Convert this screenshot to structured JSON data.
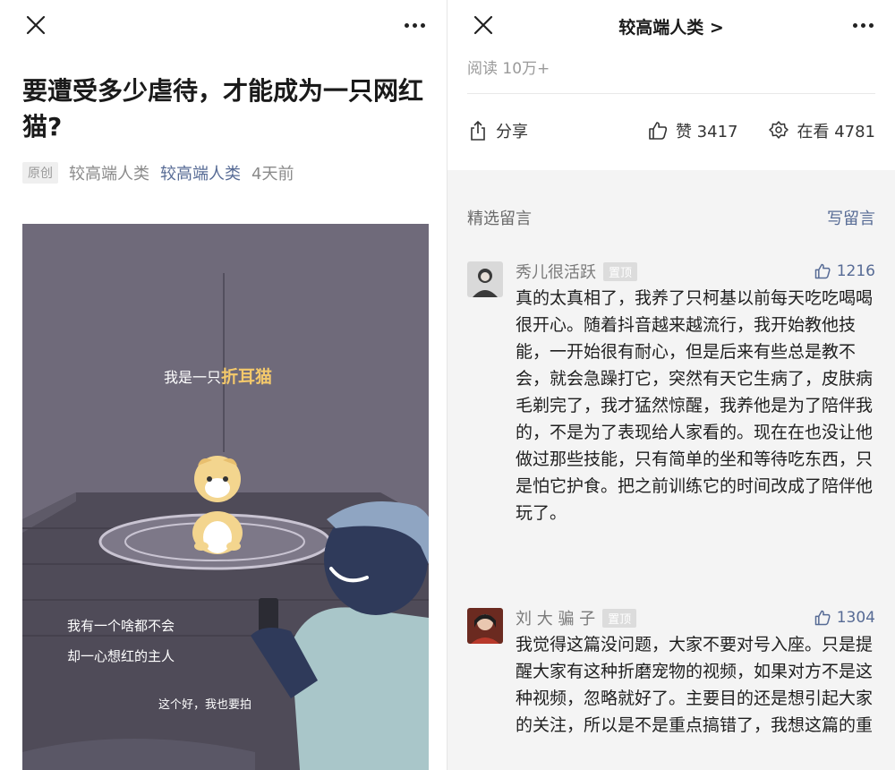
{
  "left": {
    "title": "要遭受多少虐待，才能成为一只网红猫?",
    "meta": {
      "original_tag": "原创",
      "author": "较高端人类",
      "account": "较高端人类",
      "time": "4天前"
    },
    "illustration": {
      "caption1_prefix": "我是一只",
      "caption1_highlight": "折耳猫",
      "caption2_line1": "我有一个啥都不会",
      "caption2_line2": "却一心想红的主人",
      "caption3": "这个好，我也要拍"
    }
  },
  "right": {
    "header_title": "较高端人类 >",
    "read_count": "阅读 10万+",
    "actions": {
      "share": "分享",
      "like": "赞 3417",
      "watching": "在看 4781"
    },
    "comments_label": "精选留言",
    "write_comment": "写留言",
    "comments": [
      {
        "name": "秀儿很活跃",
        "pin": "置顶",
        "likes": "1216",
        "text": "真的太真相了，我养了只柯基以前每天吃吃喝喝很开心。随着抖音越来越流行，我开始教他技能，一开始很有耐心，但是后来有些总是教不会，就会急躁打它，突然有天它生病了，皮肤病毛剃完了，我才猛然惊醒，我养他是为了陪伴我的，不是为了表现给人家看的。现在在也没让他做过那些技能，只有简单的坐和等待吃东西，只是怕它护食。把之前训练它的时间改成了陪伴他玩了。"
      },
      {
        "name": "刘 大 骗 子",
        "pin": "置顶",
        "likes": "1304",
        "text": "我觉得这篇没问题，大家不要对号入座。只是提醒大家有这种折磨宠物的视频，如果对方不是这种视频，忽略就好了。主要目的还是想引起大家的关注，所以是不是重点搞错了，我想这篇的重"
      }
    ]
  },
  "colors": {
    "link": "#576b95",
    "illustration_bg": "#6f6a7a",
    "highlight": "#f4c96b"
  }
}
